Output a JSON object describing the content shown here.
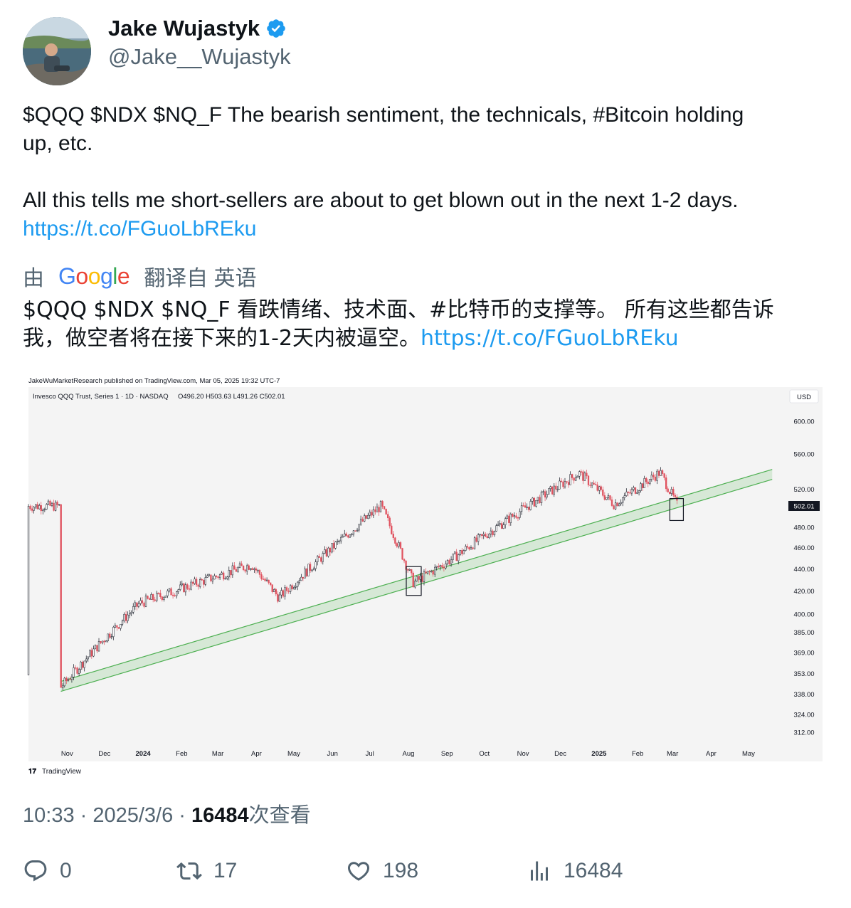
{
  "author": {
    "name": "Jake Wujastyk",
    "handle": "@Jake__Wujastyk"
  },
  "tweet": {
    "line1": "$QQQ $NDX $NQ_F The bearish sentiment, the technicals, #Bitcoin holding",
    "line2": "up, etc.",
    "line3": "All this tells me short-sellers are about to get blown out in the next 1-2 days.",
    "link": "https://t.co/FGuoLbREku"
  },
  "translation": {
    "prefix": "由",
    "google": "Google",
    "suffix": "翻译自 英语",
    "line1": "$QQQ $NDX $NQ_F 看跌情绪、技术面、#比特币的支撑等。 所有这些都告诉",
    "line2": "我，做空者将在接下来的1-2天内被逼空。",
    "link": "https://t.co/FGuoLbREku"
  },
  "chart_data": {
    "type": "candlestick",
    "publisher": "JakeWuMarketResearch published on TradingView.com, Mar 05, 2025 19:32 UTC-7",
    "symbol": "Invesco QQQ Trust, Series 1 · 1D · NASDAQ",
    "ohlc": "O496.20  H503.63  L491.26  C502.01",
    "currency": "USD",
    "last_price": "502.01",
    "brand": "TradingView",
    "y_ticks": [
      "600.00",
      "560.00",
      "520.00",
      "480.00",
      "460.00",
      "440.00",
      "420.00",
      "400.00",
      "385.00",
      "369.00",
      "353.00",
      "338.00",
      "324.00",
      "312.00"
    ],
    "x_ticks": [
      "Nov",
      "Dec",
      "2024",
      "Feb",
      "Mar",
      "Apr",
      "May",
      "Jun",
      "Jul",
      "Aug",
      "Sep",
      "Oct",
      "Nov",
      "Dec",
      "2025",
      "Feb",
      "Mar",
      "Apr",
      "May"
    ],
    "y_scale": "log",
    "key_points": [
      {
        "x": "2023-10-27",
        "y": 343
      },
      {
        "x": "2023-12-29",
        "y": 409
      },
      {
        "x": "2024-03-28",
        "y": 444
      },
      {
        "x": "2024-04-19",
        "y": 414
      },
      {
        "x": "2024-07-10",
        "y": 502
      },
      {
        "x": "2024-08-05",
        "y": 427
      },
      {
        "x": "2024-09-06",
        "y": 450
      },
      {
        "x": "2024-12-16",
        "y": 538
      },
      {
        "x": "2025-01-13",
        "y": 504
      },
      {
        "x": "2025-02-19",
        "y": 539
      },
      {
        "x": "2025-03-05",
        "y": 502
      }
    ],
    "support_channel": {
      "start": {
        "x": "2023-10-27",
        "y": 340
      },
      "end": {
        "x": "2025-05-20",
        "y": 531
      }
    },
    "highlight_boxes": [
      {
        "x": "2024-08-05"
      },
      {
        "x": "2025-03-04"
      }
    ]
  },
  "meta": {
    "time": "10:33 · 2025/3/6 · ",
    "views_num": "16484",
    "views_label": "次查看"
  },
  "actions": {
    "replies": "0",
    "reposts": "17",
    "likes": "198",
    "views": "16484"
  }
}
